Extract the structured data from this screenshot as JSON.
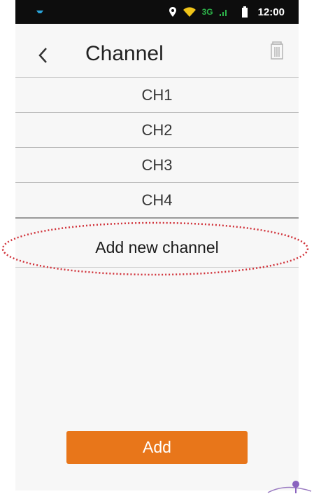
{
  "status_bar": {
    "network": "3G",
    "time": "12:00"
  },
  "header": {
    "title": "Channel",
    "back_icon": "chevron-left-icon",
    "delete_icon": "trash-icon"
  },
  "channels": [
    {
      "label": "CH1"
    },
    {
      "label": "CH2"
    },
    {
      "label": "CH3"
    },
    {
      "label": "CH4"
    }
  ],
  "add_new_channel": {
    "label": "Add new channel",
    "highlight_color": "#d1333b"
  },
  "add_button": {
    "label": "Add",
    "color": "#e8761a"
  }
}
